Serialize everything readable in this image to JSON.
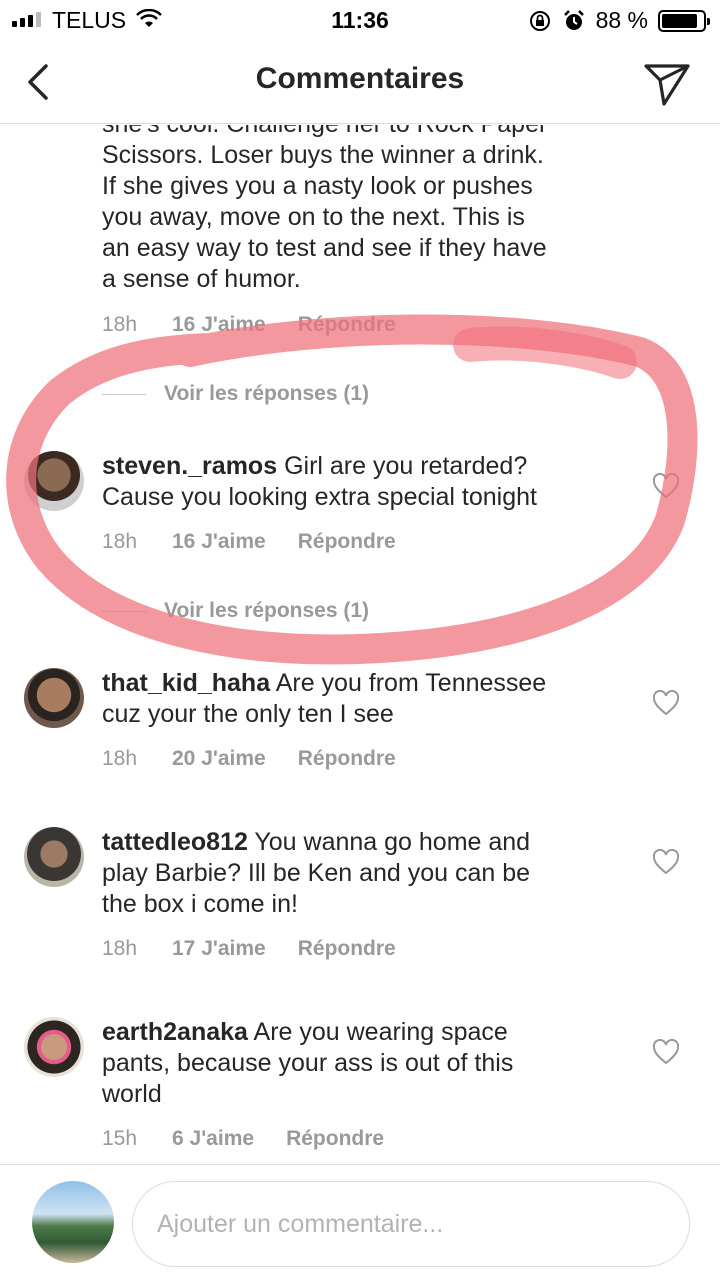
{
  "status_bar": {
    "carrier": "TELUS",
    "time": "11:36",
    "battery_text": "88 %",
    "battery_level": 0.88
  },
  "header": {
    "title": "Commentaires"
  },
  "partial_comment": {
    "lines": [
      "she's cool.  Challenge her to Rock Paper",
      "Scissors.  Loser buys the winner a drink.",
      "If she gives you a nasty look or pushes",
      "you away, move on to the next.  This is",
      "an easy way to test and see if they have",
      "a sense of humor."
    ],
    "time": "18h",
    "likes": "16 J'aime",
    "reply": "Répondre",
    "view_replies": "Voir les réponses (1)"
  },
  "comments": [
    {
      "username": "steven._ramos",
      "lines": [
        "Girl are you retarded?",
        "Cause you looking extra special tonight"
      ],
      "time": "18h",
      "likes": "16 J'aime",
      "reply": "Répondre",
      "view_replies": "Voir les réponses (1)"
    },
    {
      "username": "that_kid_haha",
      "lines": [
        "Are you from Tennessee",
        "cuz your the only ten I see"
      ],
      "time": "18h",
      "likes": "20 J'aime",
      "reply": "Répondre"
    },
    {
      "username": "tattedleo812",
      "lines": [
        "You wanna go home and",
        "play Barbie? Ill be Ken and you can be",
        "the box i come in!"
      ],
      "time": "18h",
      "likes": "17 J'aime",
      "reply": "Répondre"
    },
    {
      "username": "earth2anaka",
      "lines": [
        "Are you wearing space",
        "pants, because your ass is out of this",
        "world"
      ],
      "time": "15h",
      "likes": "6 J'aime",
      "reply": "Répondre"
    }
  ],
  "composer": {
    "placeholder": "Ajouter un commentaire..."
  },
  "colors": {
    "text": "#262626",
    "secondary": "#999999",
    "border": "#dbdbdb",
    "highlight": "#f0707a"
  }
}
